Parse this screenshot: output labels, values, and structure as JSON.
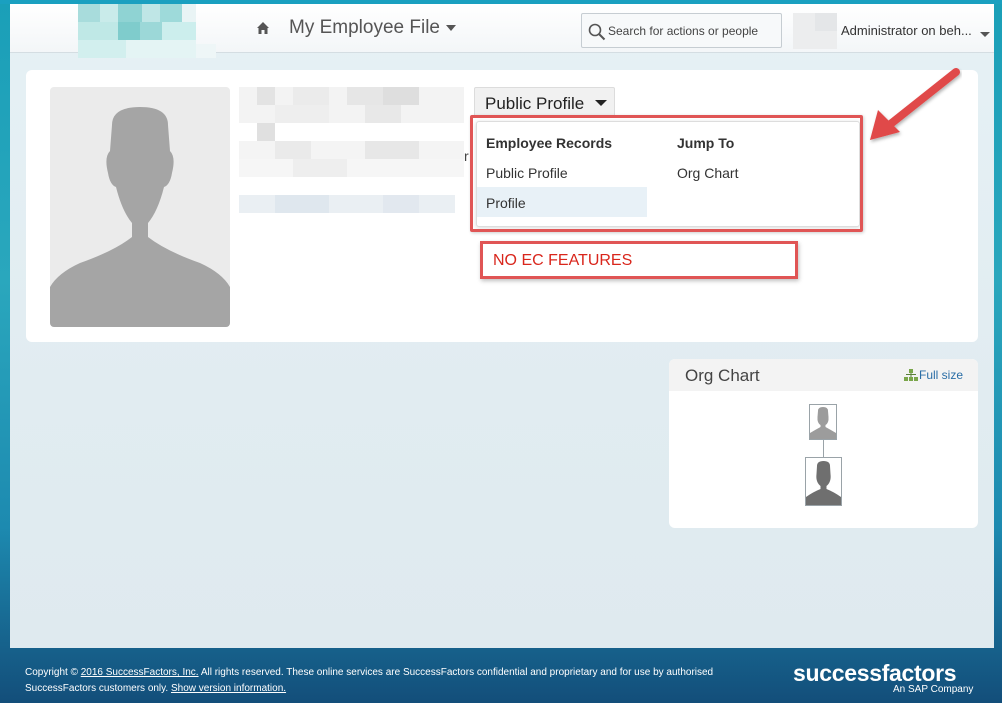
{
  "header": {
    "nav_title": "My Employee File",
    "search_placeholder": "Search for actions or people",
    "user_label": "Administrator on beh..."
  },
  "profile": {
    "view_button_label": "Public Profile",
    "partial_visible_char": "r"
  },
  "menu": {
    "employee_records": {
      "heading": "Employee Records",
      "items": [
        "Public Profile",
        "Profile"
      ],
      "selected_index": 1
    },
    "jump_to": {
      "heading": "Jump To",
      "items": [
        "Org Chart"
      ]
    }
  },
  "annotation": {
    "note": "NO EC FEATURES",
    "color": "#e05555"
  },
  "org_chart": {
    "title": "Org Chart",
    "full_size_label": "Full size"
  },
  "footer": {
    "copyright_prefix": "Copyright ©",
    "copyright_link": "2016 SuccessFactors, Inc.",
    "copyright_text": "All rights reserved. These online services are SuccessFactors confidential and proprietary and for use by authorised SuccessFactors customers only.",
    "version_link": "Show version information.",
    "brand": "successfactors",
    "brand_sub": "An SAP Company"
  },
  "colors": {
    "accent": "#1a9fb8",
    "link": "#2a6ea6",
    "annotation_red": "#e05555"
  }
}
